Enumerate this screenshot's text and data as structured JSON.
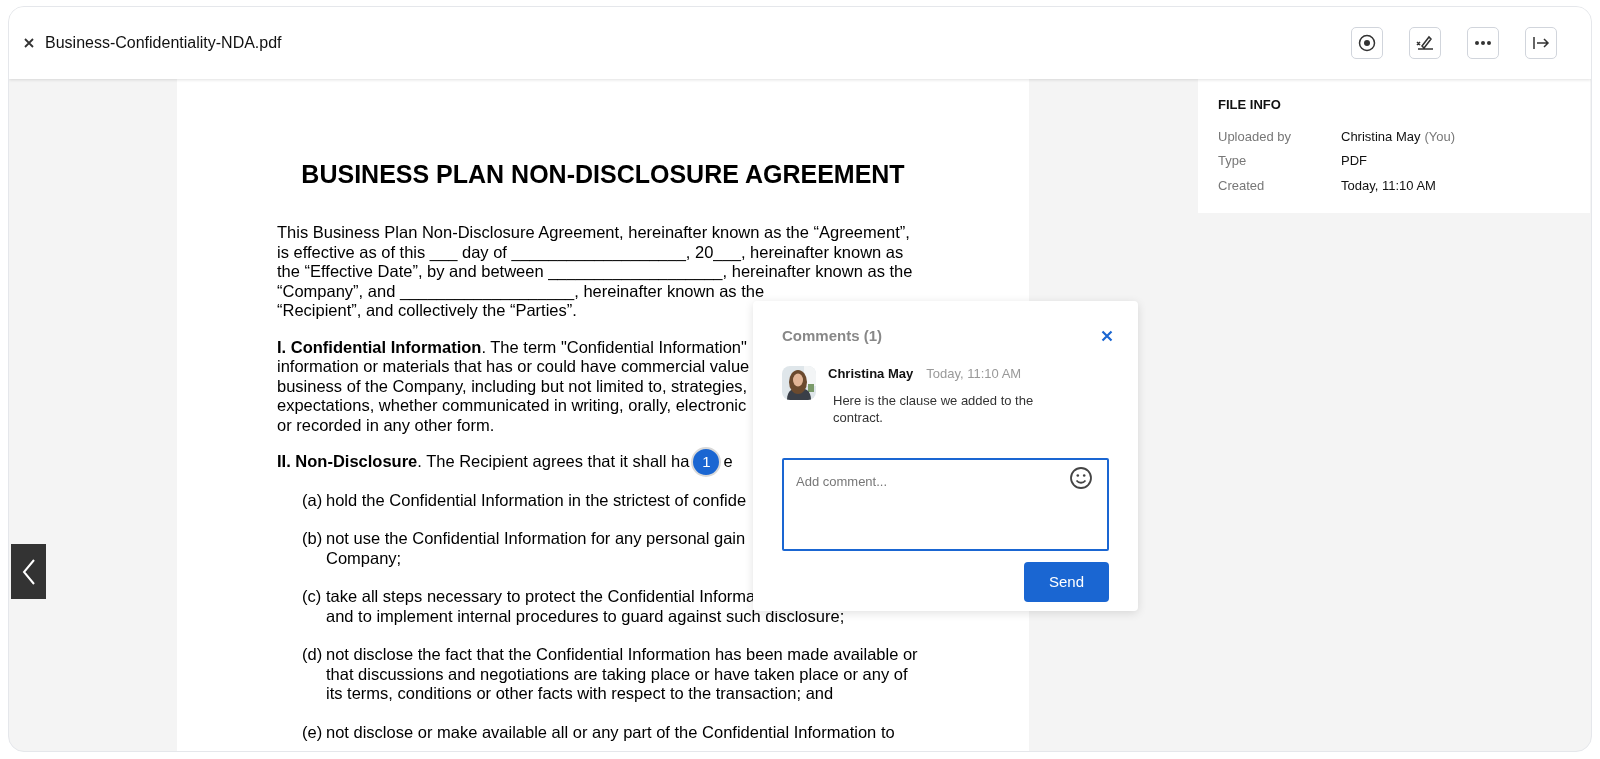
{
  "header": {
    "filename": "Business-Confidentiality-NDA.pdf"
  },
  "document": {
    "title": "BUSINESS PLAN NON-DISCLOSURE AGREEMENT",
    "paragraphs": [
      {
        "lines": [
          "This Business Plan Non-Disclosure Agreement, hereinafter known as the “Agreement”,",
          "is effective as of this ___ day of ___________________, 20___, hereinafter known as",
          "the “Effective Date”, by and between ___________________, hereinafter known as the",
          "“Company”, and ___________________, hereinafter known as the",
          "“Recipient”, and collectively the “Parties”."
        ]
      },
      {
        "lines": [
          "**I. Confidential Information**. The term \"Confidential Information\"",
          "information or materials that has or could have commercial value",
          "business of the Company, including but not limited to, strategies,",
          "expectations, whether communicated in writing, orally, electronic",
          "or recorded in any other form."
        ]
      },
      {
        "lines": [
          "**II. Non-Disclosure**. The Recipient agrees that it shall ha"
        ],
        "marker": "1",
        "marker_tail": "e"
      }
    ],
    "items": [
      {
        "label": "(a)",
        "lines": [
          "hold the Confidential Information in the strictest of confide"
        ]
      },
      {
        "label": "(b)",
        "lines": [
          "not use the Confidential Information for any personal gain",
          "Company;"
        ]
      },
      {
        "label": "(c)",
        "lines": [
          "take all steps necessary to protect the Confidential Informa",
          "and to implement internal procedures to guard against such disclosure;"
        ]
      },
      {
        "label": "(d)",
        "lines": [
          "not disclose the fact that the Confidential Information has been made available or",
          "that discussions and negotiations are taking place or have taken place or any of",
          "its terms, conditions or other facts with respect to the transaction; and"
        ]
      },
      {
        "label": "(e)",
        "lines": [
          "not disclose or make available all or any part of the Confidential Information to"
        ]
      }
    ]
  },
  "comments": {
    "title": "Comments (1)",
    "items": [
      {
        "author": "Christina May",
        "time": "Today, 11:10 AM",
        "text": "Here is the clause we added to the contract."
      }
    ],
    "input": {
      "placeholder": "Add comment..."
    },
    "send": "Send"
  },
  "file_info": {
    "title": "FILE INFO",
    "rows": [
      {
        "label": "Uploaded by",
        "value": "Christina May",
        "note": "(You)"
      },
      {
        "label": "Type",
        "value": "PDF"
      },
      {
        "label": "Created",
        "value": "Today, 11:10 AM"
      }
    ]
  }
}
